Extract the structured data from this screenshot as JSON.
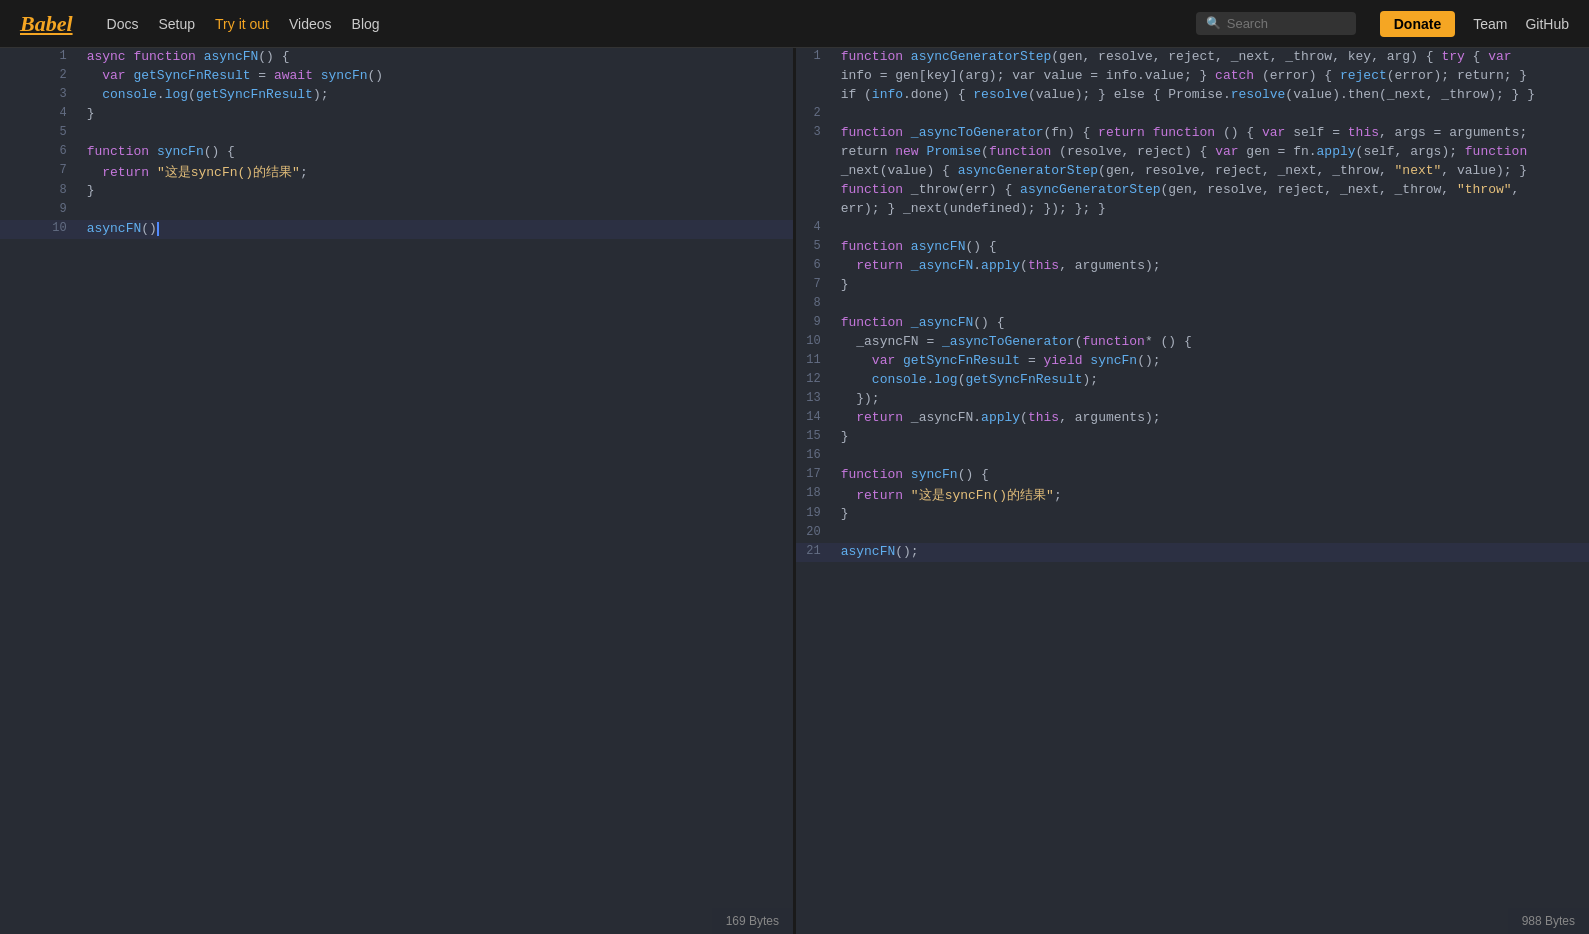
{
  "nav": {
    "logo": "Babel",
    "links": [
      {
        "label": "Docs",
        "active": false
      },
      {
        "label": "Setup",
        "active": false
      },
      {
        "label": "Try it out",
        "active": true
      },
      {
        "label": "Videos",
        "active": false
      },
      {
        "label": "Blog",
        "active": false
      }
    ],
    "search_placeholder": "Search",
    "donate_label": "Donate",
    "team_label": "Team",
    "github_label": "GitHub"
  },
  "left_pane": {
    "status_bar": "169 Bytes"
  },
  "right_pane": {
    "status_bar": "988 Bytes"
  }
}
